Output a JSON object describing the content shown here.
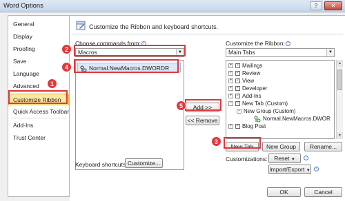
{
  "window": {
    "title": "Word Options",
    "controls": {
      "help": "?",
      "close": "✕"
    }
  },
  "nav": {
    "items": [
      {
        "label": "General"
      },
      {
        "label": "Display"
      },
      {
        "label": "Proofing"
      },
      {
        "label": "Save"
      },
      {
        "label": "Language"
      },
      {
        "label": "Advanced"
      },
      {
        "label": "Customize Ribbon"
      },
      {
        "label": "Quick Access Toolbar"
      },
      {
        "label": "Add-Ins"
      },
      {
        "label": "Trust Center"
      }
    ],
    "selected": "Customize Ribbon"
  },
  "main": {
    "header": "Customize the Ribbon and keyboard shortcuts.",
    "left": {
      "label": "Choose commands from:",
      "selected": "Macros",
      "items": [
        {
          "label": "Normal.NewMacros.DWORDR"
        }
      ]
    },
    "right": {
      "label": "Customize the Ribbon:",
      "selected": "Main Tabs",
      "tree": [
        {
          "label": "Mailings",
          "checked": true
        },
        {
          "label": "Review",
          "checked": true
        },
        {
          "label": "View",
          "checked": true
        },
        {
          "label": "Developer",
          "checked": true
        },
        {
          "label": "Add-Ins",
          "checked": true
        },
        {
          "label": "New Tab (Custom)",
          "checked": true
        },
        {
          "label": "New Group (Custom)"
        },
        {
          "label": "Normal.NewMacros.DWOR"
        },
        {
          "label": "Blog Post",
          "checked": true
        }
      ]
    },
    "buttons": {
      "add": "Add >>",
      "remove": "<< Remove",
      "new_tab": "New Tab",
      "new_group": "New Group",
      "rename": "Rename...",
      "reset": "Reset",
      "import_export": "Import/Export",
      "customize": "Customize...",
      "ok": "OK",
      "cancel": "Cancel"
    },
    "keyboard_shortcuts_label": "Keyboard shortcuts:",
    "customizations_label": "Customizations:"
  },
  "annotations": [
    "1",
    "2",
    "3",
    "4",
    "5"
  ],
  "colors": {
    "annotation": "#e0383c",
    "selected_nav": "#fde8a0",
    "selected_item": "#dbe8f7"
  }
}
